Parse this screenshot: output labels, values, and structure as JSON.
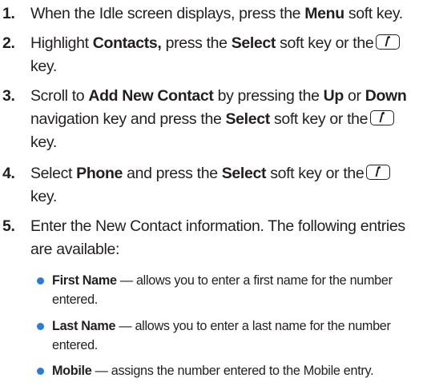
{
  "steps": [
    {
      "number": "1.",
      "pre": "When the Idle screen displays, press the ",
      "b1": "Menu",
      "post": " soft key."
    },
    {
      "number": "2.",
      "pre": "Highlight ",
      "b1": "Contacts,",
      "mid": " press the ",
      "b2": "Select",
      "post": " soft key or the",
      "tail": "key."
    },
    {
      "number": "3.",
      "pre": "Scroll to ",
      "b1": "Add New Contact",
      "mid": " by pressing the ",
      "b2": "Up",
      "mid2": " or ",
      "b3": "Down",
      "line2a": "navigation key and press the ",
      "b4": "Select",
      "line2b": " soft key or the",
      "tail": "key."
    },
    {
      "number": "4.",
      "pre": "Select ",
      "b1": "Phone",
      "mid": " and press the ",
      "b2": "Select",
      "post": " soft key or the",
      "tail": "key."
    },
    {
      "number": "5.",
      "line1": "Enter the New Contact information. The following entries",
      "line2": "are available:"
    }
  ],
  "bullets": [
    {
      "term": "First Name",
      "desc": " — allows you to enter a first name for the number",
      "cont": "entered."
    },
    {
      "term": "Last Name",
      "desc": " — allows you to enter a last name for the number",
      "cont": "entered."
    },
    {
      "term": "Mobile",
      "desc": " — assigns the number entered to the Mobile entry."
    }
  ],
  "icons": {
    "key": "i-key-icon",
    "bullet_color": "#2b7bd8"
  }
}
